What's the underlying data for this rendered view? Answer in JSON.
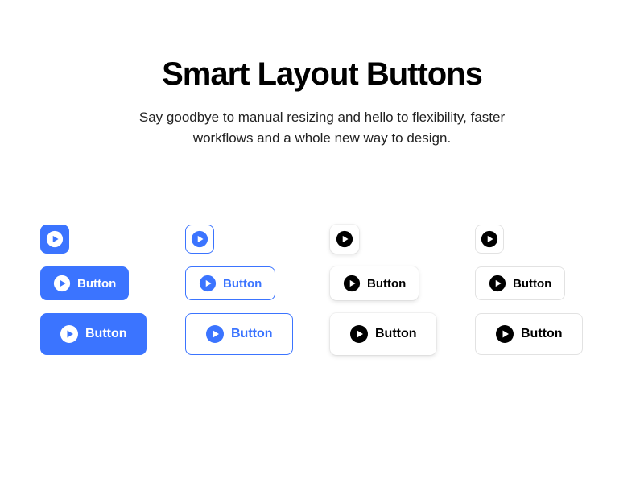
{
  "header": {
    "title": "Smart Layout Buttons",
    "subtitle": "Say goodbye to manual resizing and hello to flexibility, faster workflows and a whole new way to design."
  },
  "buttons": {
    "label": "Button"
  },
  "colors": {
    "blue": "#3B74FF",
    "black": "#000000",
    "white": "#FFFFFF"
  }
}
